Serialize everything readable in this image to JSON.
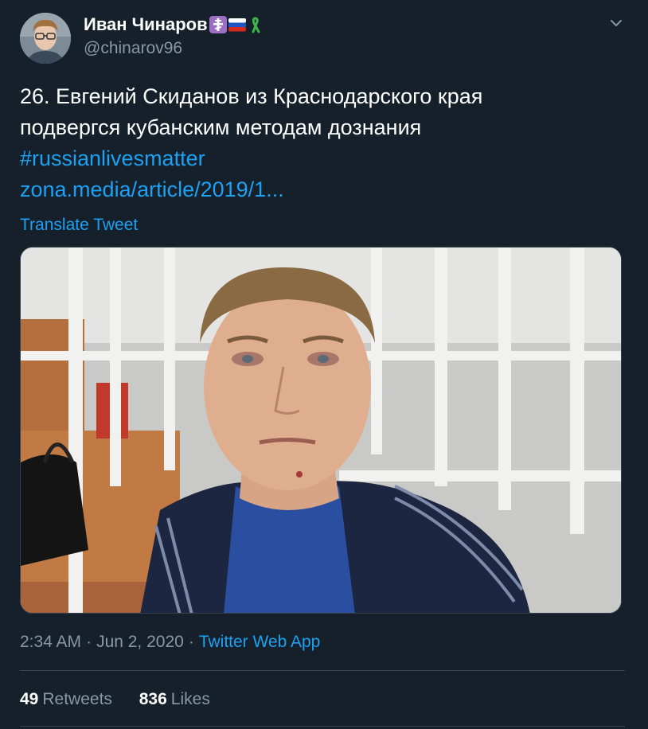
{
  "author": {
    "display_name": "Иван Чинаров",
    "handle": "@chinarov96",
    "badges": [
      "orthodox-cross-icon",
      "russian-flag-icon",
      "green-ribbon-icon"
    ]
  },
  "tweet": {
    "line1": "26. Евгений Скиданов из Краснодарского края",
    "line2": "подвергся кубанским методам дознания",
    "hashtag": "#russianlivesmatter",
    "link": "zona.media/article/2019/1...",
    "translate_label": "Translate Tweet"
  },
  "meta": {
    "time": "2:34 AM",
    "date": "Jun 2, 2020",
    "separator": "·",
    "source": "Twitter Web App"
  },
  "stats": {
    "retweets_count": "49",
    "retweets_label": "Retweets",
    "likes_count": "836",
    "likes_label": "Likes"
  },
  "colors": {
    "background": "#15202b",
    "accent": "#1da1f2",
    "secondary_text": "#8899a6",
    "border": "#38444d"
  }
}
